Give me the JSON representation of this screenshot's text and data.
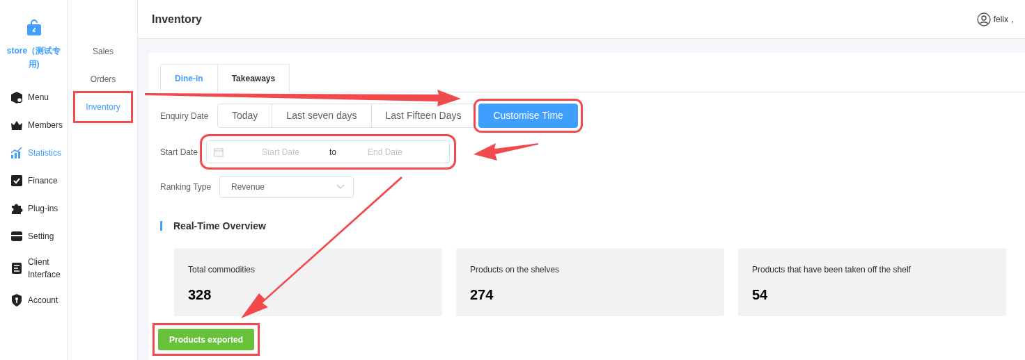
{
  "sidebar": {
    "store_name": "store（测试专用)",
    "items": [
      {
        "label": "Menu",
        "selected": false
      },
      {
        "label": "Members",
        "selected": false
      },
      {
        "label": "Statistics",
        "selected": true
      },
      {
        "label": "Finance",
        "selected": false
      },
      {
        "label": "Plug-ins",
        "selected": false
      },
      {
        "label": "Setting",
        "selected": false
      },
      {
        "label": "Client Interface",
        "selected": false
      },
      {
        "label": "Account",
        "selected": false
      }
    ]
  },
  "subnav": {
    "items": [
      {
        "label": "Sales",
        "selected": false,
        "highlighted": false
      },
      {
        "label": "Orders",
        "selected": false,
        "highlighted": false
      },
      {
        "label": "Inventory",
        "selected": true,
        "highlighted": true
      }
    ]
  },
  "header": {
    "title": "Inventory",
    "user": "felix，"
  },
  "tabs": [
    {
      "label": "Dine-in",
      "selected": true
    },
    {
      "label": "Takeaways",
      "selected": false
    }
  ],
  "filters": {
    "enquiry_label": "Enquiry Date",
    "ranges": [
      {
        "label": "Today",
        "selected": false,
        "highlighted": false
      },
      {
        "label": "Last seven days",
        "selected": false,
        "highlighted": false
      },
      {
        "label": "Last Fifteen Days",
        "selected": false,
        "highlighted": false
      },
      {
        "label": "Customise Time",
        "selected": true,
        "highlighted": true
      }
    ],
    "start_label": "Start Date",
    "date_range": {
      "start_placeholder": "Start Date",
      "separator": "to",
      "end_placeholder": "End Date",
      "highlighted": true
    },
    "ranking_label": "Ranking Type",
    "ranking_value": "Revenue"
  },
  "overview": {
    "title": "Real-Time Overview",
    "cards": [
      {
        "label": "Total commodities",
        "value": "328"
      },
      {
        "label": "Products on the shelves",
        "value": "274"
      },
      {
        "label": "Products that have been taken off the shelf",
        "value": "54"
      }
    ]
  },
  "export_button": {
    "label": "Products exported",
    "highlighted": true
  }
}
